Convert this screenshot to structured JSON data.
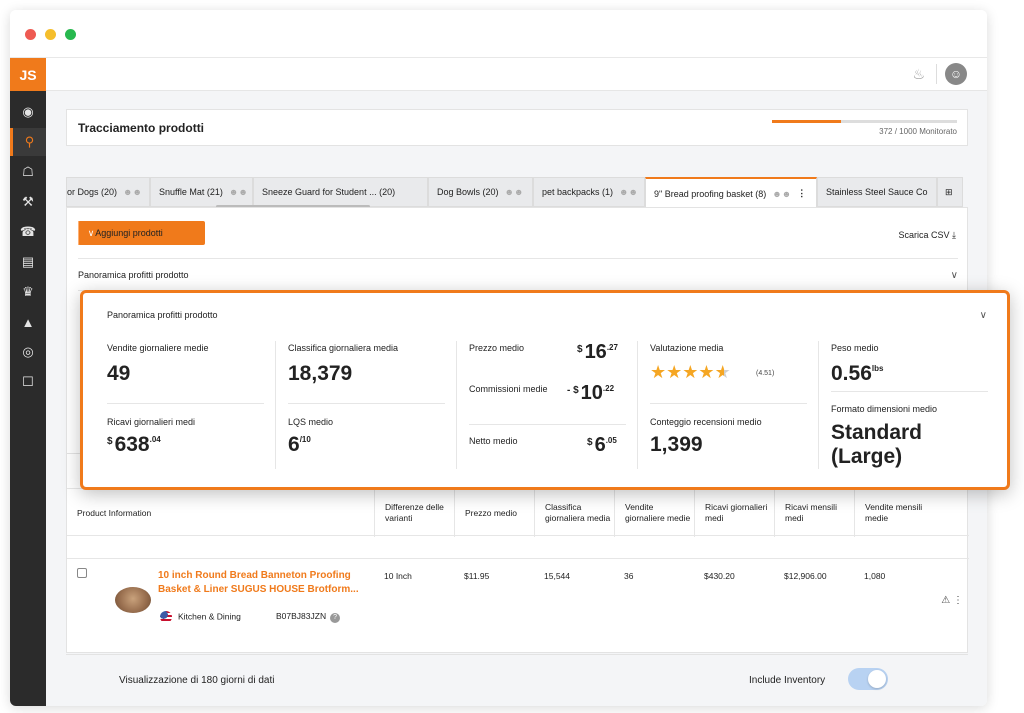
{
  "app": {
    "logo": "JS"
  },
  "header": {
    "title": "Tracciamento prodotti",
    "tracked_text": "372 / 1000 Monitorato",
    "tracked_fraction": 0.372
  },
  "tabs": [
    {
      "label": "or Dogs (20)"
    },
    {
      "label": "Snuffle Mat (21)"
    },
    {
      "label": "Sneeze Guard for Student ... (20)"
    },
    {
      "label": "Dog Bowls (20)"
    },
    {
      "label": "pet backpacks (1)"
    },
    {
      "label": "9\" Bread proofing basket (8)"
    },
    {
      "label": "Stainless Steel Sauce Co"
    }
  ],
  "toolbar": {
    "add_label": "Aggiungi prodotti",
    "csv_label": "Scarica CSV"
  },
  "overview": {
    "label": "Panoramica profitti prodotto"
  },
  "popup": {
    "title": "Panoramica profitti prodotto",
    "avg_daily_sales_label": "Vendite giornaliere medie",
    "avg_daily_sales": "49",
    "avg_daily_revenue_label": "Ricavi giornalieri medi",
    "avg_daily_revenue_currency": "$",
    "avg_daily_revenue_int": "638",
    "avg_daily_revenue_dec": ".04",
    "avg_rank_label": "Classifica giornaliera media",
    "avg_rank": "18,379",
    "lqs_label": "LQS medio",
    "lqs_value": "6",
    "lqs_max": "/10",
    "avg_price_label": "Prezzo medio",
    "avg_price_currency": "$",
    "avg_price_int": "16",
    "avg_price_dec": ".27",
    "fees_label": "Commissioni medie",
    "fees_currency": "- $",
    "fees_int": "10",
    "fees_dec": ".22",
    "net_label": "Netto medio",
    "net_currency": "$",
    "net_int": "6",
    "net_dec": ".05",
    "rating_label": "Valutazione media",
    "rating_value": 4.51,
    "rating_text": "(4.51)",
    "reviews_label": "Conteggio recensioni medio",
    "reviews_value": "1,399",
    "weight_label": "Peso medio",
    "weight_value": "0.56",
    "weight_unit": "lbs",
    "size_label": "Formato dimensioni medio",
    "size_value_1": "Standard",
    "size_value_2": "(Large)"
  },
  "table": {
    "headers": [
      "Product Information",
      "Differenze delle varianti",
      "Prezzo medio",
      "Classifica giornaliera media",
      "Vendite giornaliere medie",
      "Ricavi giornalieri medi",
      "Ricavi mensili medi",
      "Vendite mensili medie"
    ],
    "row": {
      "title": "10 inch Round Bread Banneton Proofing Basket & Liner SUGUS HOUSE Brotform...",
      "variant": "10 Inch",
      "price": "$11.95",
      "rank": "15,544",
      "daily_sales": "36",
      "daily_revenue": "$430.20",
      "monthly_revenue": "$12,906.00",
      "monthly_sales": "1,080",
      "category": "Kitchen & Dining",
      "asin": "B07BJ83JZN"
    }
  },
  "footer": {
    "days_text": "Visualizzazione di 180 giorni di dati",
    "include_label": "Include Inventory",
    "include_on": true
  },
  "colors": {
    "accent": "#f07a1b",
    "sidebar": "#2b2b2b",
    "star": "#f5a623"
  }
}
